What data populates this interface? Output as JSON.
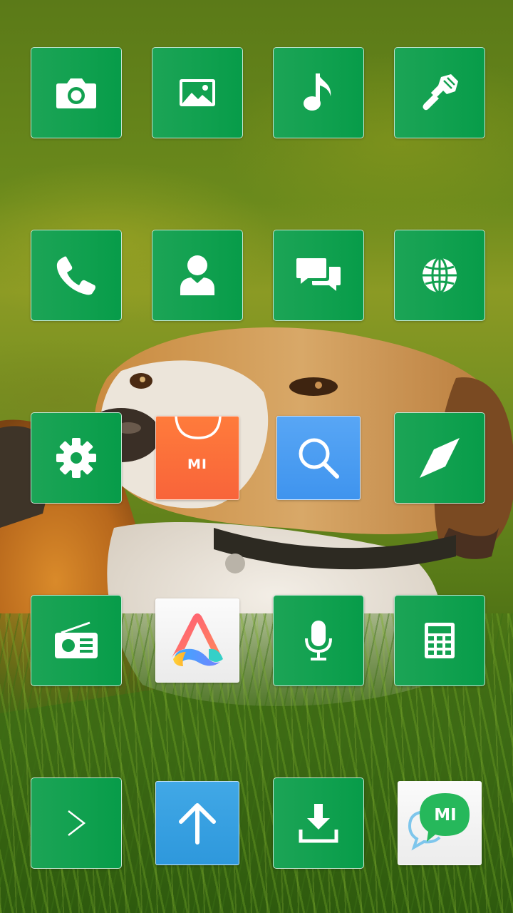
{
  "screen": {
    "type": "home-screen",
    "wallpaper": "beagle-dog-in-grass-photo"
  },
  "colors": {
    "tile_green": "#12a150",
    "store_orange": "#f8643a",
    "search_blue": "#4a9df1",
    "update_blue": "#35a0e2",
    "icon_white": "#ffffff"
  },
  "apps": [
    {
      "icon": "camera-icon"
    },
    {
      "icon": "gallery-icon"
    },
    {
      "icon": "music-icon"
    },
    {
      "icon": "themes-brush-icon"
    },
    {
      "icon": "phone-icon"
    },
    {
      "icon": "contacts-icon"
    },
    {
      "icon": "messages-icon"
    },
    {
      "icon": "browser-globe-icon"
    },
    {
      "icon": "settings-gear-icon"
    },
    {
      "icon": "mi-store-bag-icon",
      "label": "MI"
    },
    {
      "icon": "search-magnifier-icon"
    },
    {
      "icon": "compass-icon"
    },
    {
      "icon": "radio-icon"
    },
    {
      "icon": "app-vault-a-icon"
    },
    {
      "icon": "recorder-mic-icon"
    },
    {
      "icon": "calculator-icon"
    },
    {
      "icon": "terminal-chevron-icon"
    },
    {
      "icon": "updater-arrow-up-icon"
    },
    {
      "icon": "downloads-icon"
    },
    {
      "icon": "mi-talk-chat-icon",
      "label": "MI"
    }
  ]
}
